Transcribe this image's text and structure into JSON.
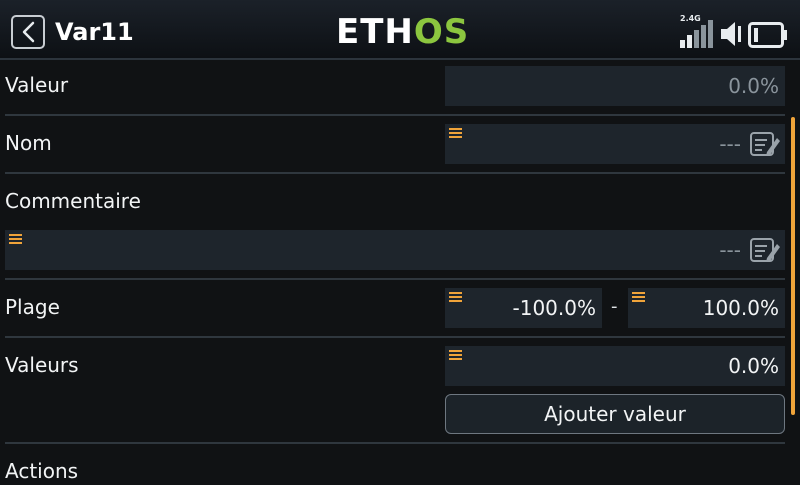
{
  "header": {
    "title": "Var11",
    "logo": {
      "part1": "ETH",
      "part2": "OS"
    },
    "band_label": "2.4G",
    "accent_color": "#8cc63f"
  },
  "rows": {
    "valeur": {
      "label": "Valeur",
      "value": "0.0%"
    },
    "nom": {
      "label": "Nom",
      "value": "---"
    },
    "commentaire": {
      "label": "Commentaire",
      "value": "---"
    },
    "plage": {
      "label": "Plage",
      "min": "-100.0%",
      "separator": "-",
      "max": "100.0%"
    },
    "valeurs": {
      "label": "Valeurs",
      "value": "0.0%",
      "add_button": "Ajouter valeur"
    },
    "actions": {
      "label": "Actions"
    }
  },
  "colors": {
    "menu_marker": "#f0a43a",
    "field_bg": "#1e252c",
    "scrollbar": "#f0a43a"
  },
  "icons": [
    "back-arrow-icon",
    "signal-bars-icon",
    "speaker-icon",
    "battery-icon",
    "menu-marker-icon",
    "edit-icon"
  ]
}
